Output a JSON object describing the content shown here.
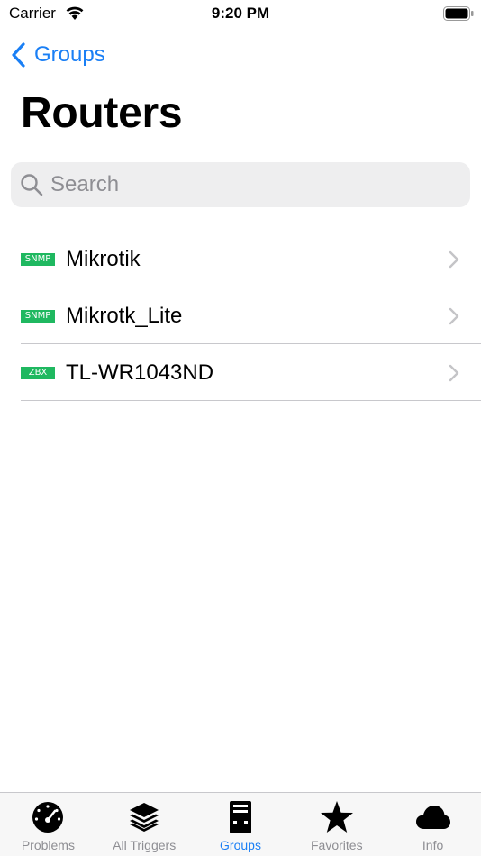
{
  "status_bar": {
    "carrier": "Carrier",
    "time": "9:20 PM"
  },
  "nav": {
    "back_label": "Groups",
    "title": "Routers"
  },
  "search": {
    "placeholder": "Search",
    "value": ""
  },
  "hosts": [
    {
      "badge": "SNMP",
      "name": "Mikrotik"
    },
    {
      "badge": "SNMP",
      "name": "Mikrotk_Lite"
    },
    {
      "badge": "ZBX",
      "name": "TL-WR1043ND"
    }
  ],
  "tabs": [
    {
      "label": "Problems",
      "icon": "gauge-icon",
      "active": false
    },
    {
      "label": "All Triggers",
      "icon": "stack-icon",
      "active": false
    },
    {
      "label": "Groups",
      "icon": "server-icon",
      "active": true
    },
    {
      "label": "Favorites",
      "icon": "star-icon",
      "active": false
    },
    {
      "label": "Info",
      "icon": "cloud-icon",
      "active": false
    }
  ],
  "colors": {
    "accent": "#1a7ff5",
    "badge": "#1fb860",
    "inactive": "#8e8e93"
  }
}
